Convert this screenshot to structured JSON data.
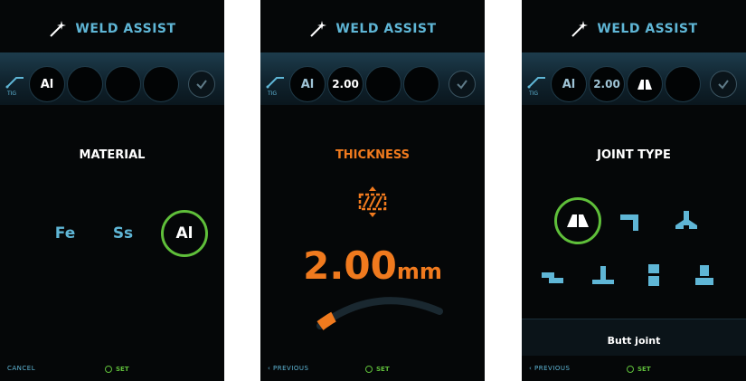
{
  "app": {
    "title": "WELD ASSIST",
    "process_label": "TIG"
  },
  "colors": {
    "accent": "#5fb6d6",
    "orange": "#f07a1e",
    "green": "#5fbf3a",
    "background": "#050708"
  },
  "panels": [
    {
      "slots": [
        "Al",
        "",
        "",
        ""
      ],
      "heading": "MATERIAL",
      "materials": [
        {
          "label": "Fe",
          "selected": false
        },
        {
          "label": "Ss",
          "selected": false
        },
        {
          "label": "Al",
          "selected": true
        }
      ],
      "footer": {
        "left": "CANCEL",
        "set": "SET"
      }
    },
    {
      "slots": [
        "Al",
        "2.00",
        "",
        ""
      ],
      "heading": "THICKNESS",
      "thickness": {
        "value": "2.00",
        "unit": "mm",
        "gauge_fraction": 0.12
      },
      "footer": {
        "left": "‹ PREVIOUS",
        "set": "SET"
      }
    },
    {
      "slots": [
        "Al",
        "2.00",
        "",
        ""
      ],
      "heading": "JOINT TYPE",
      "joints": [
        {
          "icon": "butt-joint-icon",
          "selected": true
        },
        {
          "icon": "corner-joint-icon",
          "selected": false
        },
        {
          "icon": "t-joint-icon",
          "selected": false
        },
        {
          "icon": "lap-joint-icon",
          "selected": false
        },
        {
          "icon": "fillet-joint-icon",
          "selected": false
        },
        {
          "icon": "edge-joint-icon",
          "selected": false
        },
        {
          "icon": "pipe-joint-icon",
          "selected": false
        }
      ],
      "selected_joint_name": "Butt joint",
      "footer": {
        "left": "‹ PREVIOUS",
        "set": "SET"
      }
    }
  ]
}
